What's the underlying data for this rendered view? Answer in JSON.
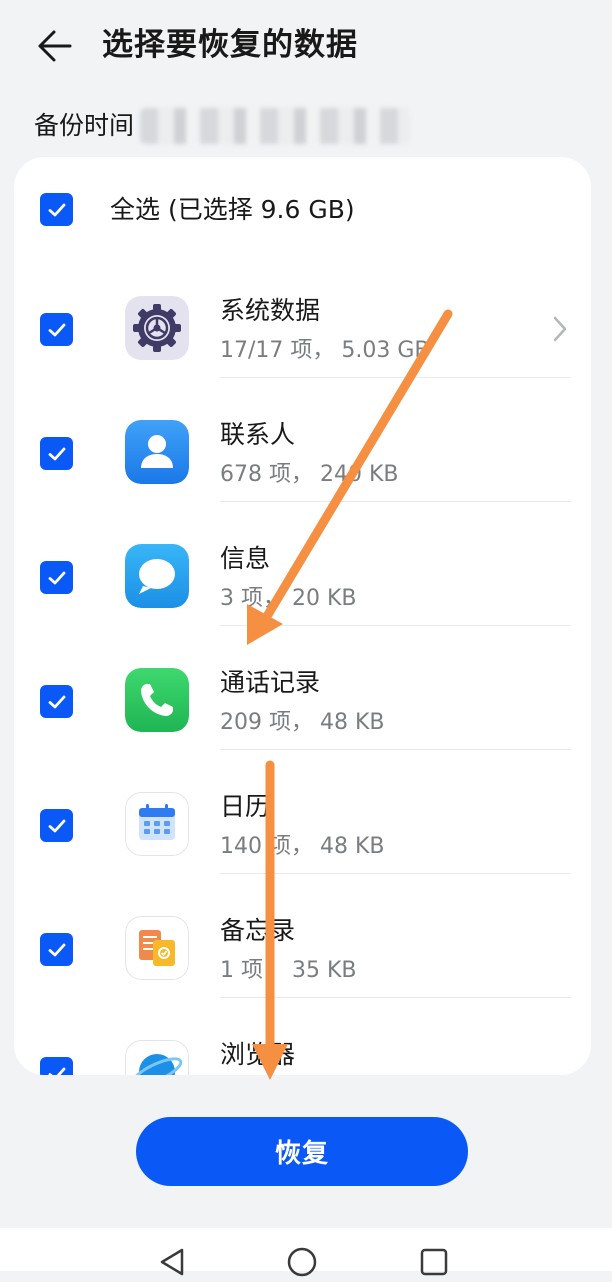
{
  "header": {
    "title": "选择要恢复的数据",
    "back_icon": "arrow-left-icon"
  },
  "backup_time": {
    "label": "备份时间",
    "value_redacted": true
  },
  "select_all": {
    "label": "全选 (已选择 9.6 GB)",
    "checked": true
  },
  "items": [
    {
      "name": "系统数据",
      "meta": "17/17 项， 5.03 GB",
      "icon": "settings-gear-icon",
      "checked": true,
      "has_chevron": true
    },
    {
      "name": "联系人",
      "meta": "678 项， 240 KB",
      "icon": "contacts-icon",
      "checked": true
    },
    {
      "name": "信息",
      "meta": "3 项， 20 KB",
      "icon": "messages-icon",
      "checked": true
    },
    {
      "name": "通话记录",
      "meta": "209 项， 48 KB",
      "icon": "phone-icon",
      "checked": true
    },
    {
      "name": "日历",
      "meta": "140 项， 48 KB",
      "icon": "calendar-icon",
      "checked": true
    },
    {
      "name": "备忘录",
      "meta": "1 项， 35 KB",
      "icon": "notepad-icon",
      "checked": true
    },
    {
      "name": "浏览器",
      "meta": "",
      "icon": "browser-icon",
      "checked": true
    }
  ],
  "restore_button": {
    "label": "恢复"
  },
  "annotations": {
    "arrow_color": "#f58f42"
  },
  "nav": {
    "back": "nav-back-icon",
    "home": "nav-home-icon",
    "recents": "nav-recents-icon"
  },
  "colors": {
    "accent": "#0a59f7",
    "background": "#f1f3f5",
    "card": "#ffffff"
  }
}
